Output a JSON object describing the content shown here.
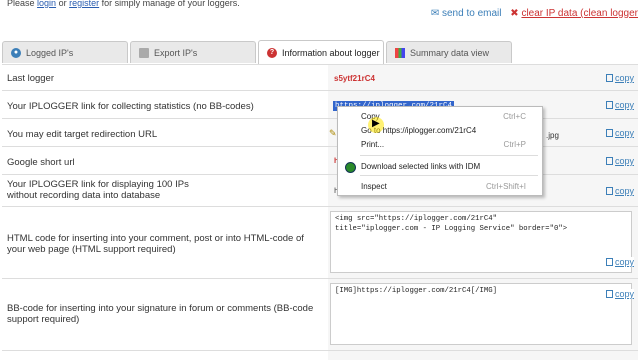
{
  "top": {
    "intro_prefix": "Please",
    "login": "login",
    "or": "or",
    "register": "register",
    "intro_suffix": "for simply manage of your loggers.",
    "send_to_email": "send to email",
    "clear_ip_data": "clear IP data (clean logger"
  },
  "tabs": [
    {
      "label": "Logged IP's",
      "icon": "globe-icon"
    },
    {
      "label": "Export IP's",
      "icon": "export-icon"
    },
    {
      "label": "Information about logger",
      "icon": "help-icon"
    },
    {
      "label": "Summary data view",
      "icon": "chart-icon"
    }
  ],
  "copy_label": "copy",
  "rows": {
    "last_logger": {
      "label": "Last logger",
      "value": "s5ytf21rC4"
    },
    "iplogger_link": {
      "label": "Your IPLOGGER link for collecting statistics (no BB-codes)",
      "value": "https://iplogger.com/21rC4"
    },
    "edit_target": {
      "label": "You may edit target redirection URL",
      "value": ".jpg"
    },
    "google_short": {
      "label": "Google short url",
      "value": "h"
    },
    "display_link": {
      "label1": "Your IPLOGGER link for displaying 100 IPs",
      "label2": "without recording data into database",
      "value": "h"
    },
    "html_code": {
      "label1": "HTML code for inserting into your comment, post or into HTML-code of",
      "label2": "your web page (HTML support required)",
      "code": "<img src=\"https://iplogger.com/21rC4\"\ntitle=\"iplogger.com - IP Logging Service\" border=\"0\">"
    },
    "bb_code": {
      "label1": "BB-code for inserting into your signature in forum or comments (BB-code",
      "label2": "support required)",
      "code": "[IMG]https://iplogger.com/21rC4[/IMG]"
    }
  },
  "context_menu": {
    "copy": "Copy",
    "copy_key": "Ctrl+C",
    "goto": "Go to https://iplogger.com/21rC4",
    "print": "Print...",
    "print_key": "Ctrl+P",
    "download_idm": "Download selected links with IDM",
    "inspect": "Inspect",
    "inspect_key": "Ctrl+Shift+I"
  },
  "colors": {
    "accent_red": "#cc3333",
    "link_blue": "#3c7fb8",
    "selection": "#3366cc"
  }
}
